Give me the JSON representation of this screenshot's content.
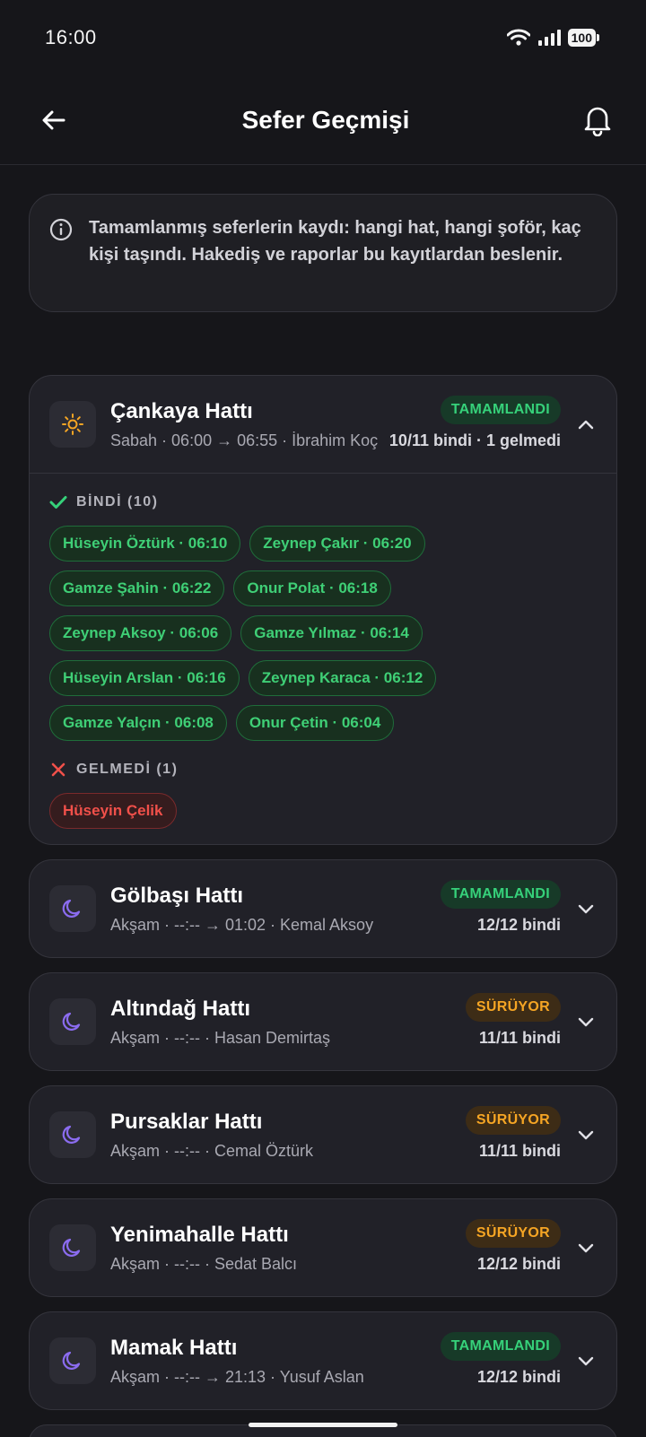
{
  "status_bar": {
    "time": "16:00",
    "battery": "100"
  },
  "header": {
    "title": "Sefer Geçmişi",
    "back_icon": "arrow-left-icon",
    "bell_icon": "bell-icon"
  },
  "info": {
    "text": "Tamamlanmış seferlerin kaydı: hangi hat, hangi şoför, kaç kişi taşındı. Hakediş ve raporlar bu kayıtlardan beslenir."
  },
  "colors": {
    "done": "#36d17a",
    "running": "#f5a524",
    "absent": "#f0504a",
    "moon": "#8b6cf0",
    "sun": "#f5a524"
  },
  "trips": [
    {
      "name": "Çankaya Hattı",
      "subtitle": "Sabah · 06:00 → 06:55 · İbrahim Koç",
      "status": "TAMAMLANDI",
      "counts": "10/11 bindi · 1 gelmedi",
      "icon": "sun-icon",
      "expanded": true,
      "boarded_label": "BİNDİ (10)",
      "boarded": [
        "Hüseyin Öztürk · 06:10",
        "Zeynep Çakır · 06:20",
        "Gamze Şahin · 06:22",
        "Onur Polat · 06:18",
        "Zeynep Aksoy · 06:06",
        "Gamze Yılmaz · 06:14",
        "Hüseyin Arslan · 06:16",
        "Zeynep Karaca · 06:12",
        "Gamze Yalçın · 06:08",
        "Onur Çetin · 06:04"
      ],
      "absent_label": "GELMEDİ (1)",
      "absent": [
        "Hüseyin Çelik"
      ]
    },
    {
      "name": "Gölbaşı Hattı",
      "subtitle": "Akşam · --:-- → 01:02 · Kemal Aksoy",
      "status": "TAMAMLANDI",
      "counts": "12/12 bindi",
      "icon": "moon-icon"
    },
    {
      "name": "Altındağ Hattı",
      "subtitle": "Akşam · --:-- · Hasan Demirtaş",
      "status": "SÜRÜYOR",
      "counts": "11/11 bindi",
      "icon": "moon-icon"
    },
    {
      "name": "Pursaklar Hattı",
      "subtitle": "Akşam · --:-- · Cemal Öztürk",
      "status": "SÜRÜYOR",
      "counts": "11/11 bindi",
      "icon": "moon-icon"
    },
    {
      "name": "Yenimahalle Hattı",
      "subtitle": "Akşam · --:-- · Sedat Balcı",
      "status": "SÜRÜYOR",
      "counts": "12/12 bindi",
      "icon": "moon-icon"
    },
    {
      "name": "Mamak Hattı",
      "subtitle": "Akşam · --:-- → 21:13 · Yusuf Aslan",
      "status": "TAMAMLANDI",
      "counts": "12/12 bindi",
      "icon": "moon-icon"
    }
  ]
}
